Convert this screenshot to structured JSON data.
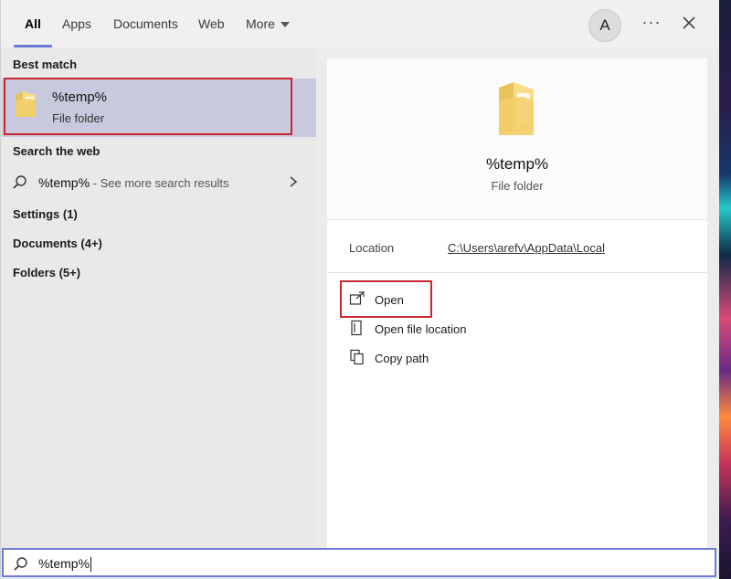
{
  "tabs": [
    {
      "label": "All",
      "active": true
    },
    {
      "label": "Apps"
    },
    {
      "label": "Documents"
    },
    {
      "label": "Web"
    },
    {
      "label": "More"
    }
  ],
  "header": {
    "avatar_letter": "A",
    "more_options": "···"
  },
  "left": {
    "best_match_heading": "Best match",
    "best": {
      "title": "%temp%",
      "subtitle": "File folder"
    },
    "web_heading": "Search the web",
    "web": {
      "query": "%temp%",
      "more": " - See more search results"
    },
    "categories": [
      "Settings (1)",
      "Documents (4+)",
      "Folders (5+)"
    ]
  },
  "preview": {
    "title": "%temp%",
    "subtitle": "File folder",
    "location_label": "Location",
    "location_path": "C:\\Users\\arefv\\AppData\\Local",
    "actions": [
      "Open",
      "Open file location",
      "Copy path"
    ]
  },
  "search": {
    "value": "%temp%"
  },
  "colors": {
    "accent": "#6f7ad6",
    "highlight": "#c8262e",
    "selection": "#c9c9de"
  }
}
